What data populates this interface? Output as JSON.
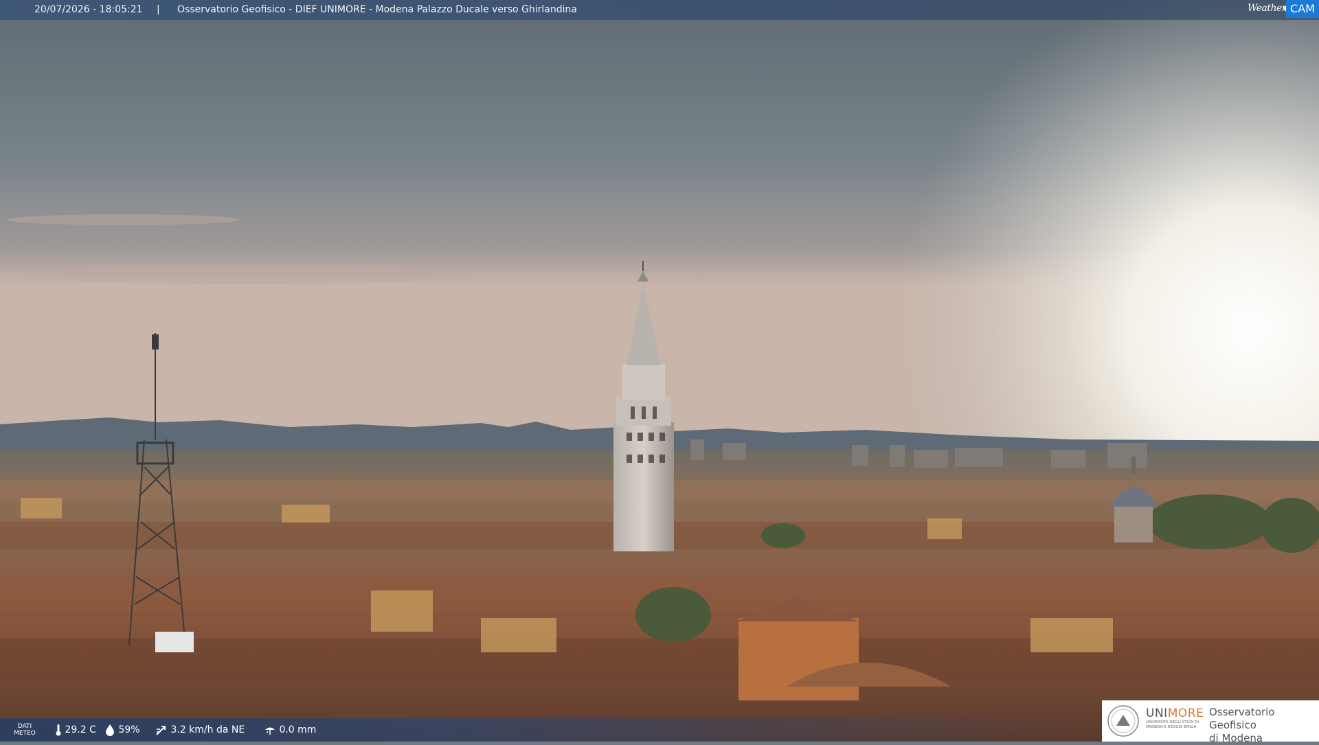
{
  "header": {
    "timestamp": "20/07/2026 - 18:05:21",
    "separator": "|",
    "title": "Osservatorio Geofisico - DIEF UNIMORE - Modena Palazzo Ducale verso Ghirlandina"
  },
  "brand_logo": {
    "part1": "Weather",
    "part2": "CAM"
  },
  "meteo": {
    "label_line1": "DATI",
    "label_line2": "METEO",
    "temperature": "29.2 C",
    "humidity": "59%",
    "wind": "3.2 km/h da NE",
    "rain": "0.0 mm",
    "icons": [
      "thermometer-icon",
      "humidity-drop-icon",
      "wind-icon",
      "rain-gauge-icon"
    ]
  },
  "partner_logo": {
    "name_gray": "UNI",
    "name_orange": "MORE",
    "subtitle": "UNIVERSITÀ DEGLI STUDI DI MODENA E REGGIO EMILIA",
    "observatory_line1": "Osservatorio Geofisico",
    "observatory_line2": "di Modena"
  },
  "colors": {
    "sky_top": "#6f7a82",
    "sky_bright": "#f3f1ea",
    "roofs": "#8a5a40",
    "accent_blue": "#1a7ad6",
    "unimore_orange": "#d87a2b"
  }
}
